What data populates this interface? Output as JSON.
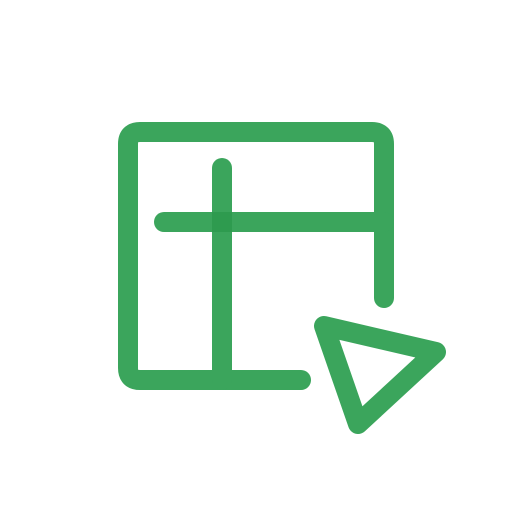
{
  "icon": {
    "name": "table-pointer-icon",
    "stroke_color": "#3BA55C",
    "overlap_color": "#2E9B4F",
    "background": "#FFFFFF"
  }
}
